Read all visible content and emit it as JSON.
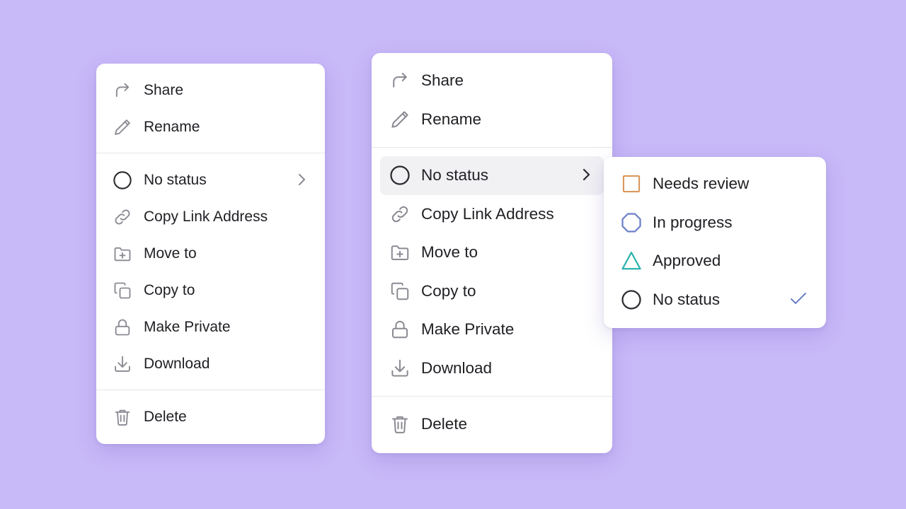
{
  "colors": {
    "background": "#c8b9f8",
    "icon_gray": "#8a8a93",
    "status_circle": "#2b2b30",
    "needs_review": "#d9975a",
    "in_progress": "#6b7fc9",
    "approved": "#2bb3ad",
    "check": "#6b7fc9",
    "highlight": "#f1f1f4"
  },
  "menu_collapsed": {
    "items": [
      {
        "label": "Share",
        "icon": "share-icon"
      },
      {
        "label": "Rename",
        "icon": "pencil-icon"
      },
      {
        "label": "No status",
        "icon": "circle-status-icon",
        "has_submenu": true
      },
      {
        "label": "Copy Link Address",
        "icon": "link-icon"
      },
      {
        "label": "Move to",
        "icon": "folder-plus-icon"
      },
      {
        "label": "Copy to",
        "icon": "copy-icon"
      },
      {
        "label": "Make Private",
        "icon": "lock-icon"
      },
      {
        "label": "Download",
        "icon": "download-icon"
      },
      {
        "label": "Delete",
        "icon": "trash-icon"
      }
    ]
  },
  "menu_expanded": {
    "highlighted_item": "No status",
    "items": [
      {
        "label": "Share",
        "icon": "share-icon"
      },
      {
        "label": "Rename",
        "icon": "pencil-icon"
      },
      {
        "label": "No status",
        "icon": "circle-status-icon",
        "has_submenu": true
      },
      {
        "label": "Copy Link Address",
        "icon": "link-icon"
      },
      {
        "label": "Move to",
        "icon": "folder-plus-icon"
      },
      {
        "label": "Copy to",
        "icon": "copy-icon"
      },
      {
        "label": "Make Private",
        "icon": "lock-icon"
      },
      {
        "label": "Download",
        "icon": "download-icon"
      },
      {
        "label": "Delete",
        "icon": "trash-icon"
      }
    ]
  },
  "status_submenu": {
    "selected": "No status",
    "items": [
      {
        "label": "Needs review",
        "icon": "square-status-icon"
      },
      {
        "label": "In progress",
        "icon": "octagon-status-icon"
      },
      {
        "label": "Approved",
        "icon": "triangle-status-icon"
      },
      {
        "label": "No status",
        "icon": "circle-status-icon",
        "checked": true
      }
    ]
  }
}
